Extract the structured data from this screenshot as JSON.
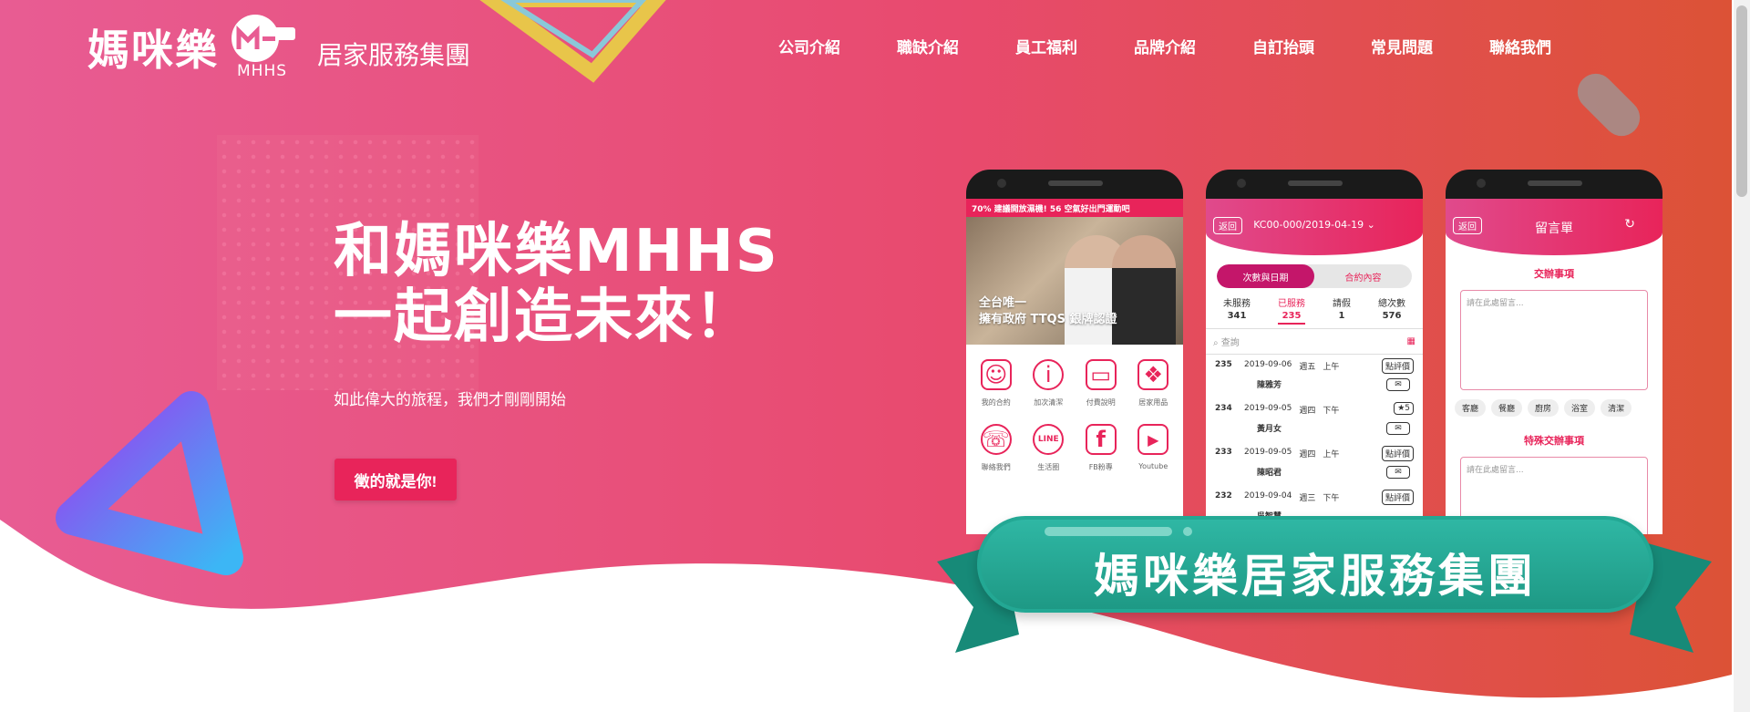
{
  "logo": {
    "name": "媽咪樂",
    "mark": "MHHS",
    "subtitle": "居家服務集團"
  },
  "nav": [
    "公司介紹",
    "職缺介紹",
    "員工福利",
    "品牌介紹",
    "自訂抬頭",
    "常見問題",
    "聯絡我們"
  ],
  "hero": {
    "title_line1": "和媽咪樂MHHS",
    "title_line2": "一起創造未來！",
    "subtitle": "如此偉大的旅程，我們才剛剛開始",
    "cta": "徵的就是你!"
  },
  "phone1": {
    "status": "70% 建議開放濕機! 56 空氣好出門運動吧",
    "caption_line1": "全台唯一",
    "caption_line2": "擁有政府 TTQS 銀牌認證",
    "grid": [
      {
        "label": "我的合約",
        "icon": "contract-icon"
      },
      {
        "label": "加次清潔",
        "icon": "info-icon"
      },
      {
        "label": "付費說明",
        "icon": "card-icon"
      },
      {
        "label": "居家用品",
        "icon": "gift-icon"
      },
      {
        "label": "聯絡我們",
        "icon": "headset-icon"
      },
      {
        "label": "生活圈",
        "icon": "line-icon"
      },
      {
        "label": "FB粉專",
        "icon": "facebook-icon"
      },
      {
        "label": "Youtube",
        "icon": "youtube-icon"
      }
    ]
  },
  "phone2": {
    "back": "返回",
    "title": "KC00-000/2019-04-19",
    "tabs": [
      "次數與日期",
      "合約內容"
    ],
    "stats": [
      {
        "label": "未服務",
        "value": "341"
      },
      {
        "label": "已服務",
        "value": "235"
      },
      {
        "label": "請假",
        "value": "1"
      },
      {
        "label": "總次數",
        "value": "576"
      }
    ],
    "search": "查詢",
    "rows": [
      {
        "id": "235",
        "date": "2019-09-06",
        "day": "週五",
        "time": "上午",
        "name": "陳雅芳",
        "action": "點評價"
      },
      {
        "id": "234",
        "date": "2019-09-05",
        "day": "週四",
        "time": "下午",
        "name": "黃月女",
        "action": "★5"
      },
      {
        "id": "233",
        "date": "2019-09-05",
        "day": "週四",
        "time": "上午",
        "name": "陳昭君",
        "action": "點評價"
      },
      {
        "id": "232",
        "date": "2019-09-04",
        "day": "週三",
        "time": "下午",
        "name": "吳智慧",
        "action": "點評價"
      }
    ]
  },
  "phone3": {
    "back": "返回",
    "title": "留言單",
    "section1": "交辦事項",
    "placeholder": "請在此處留言...",
    "chips": [
      "客廳",
      "餐廳",
      "廚房",
      "浴室",
      "清潔"
    ],
    "section2": "特殊交辦事項"
  },
  "ribbon": "媽咪樂居家服務集團"
}
